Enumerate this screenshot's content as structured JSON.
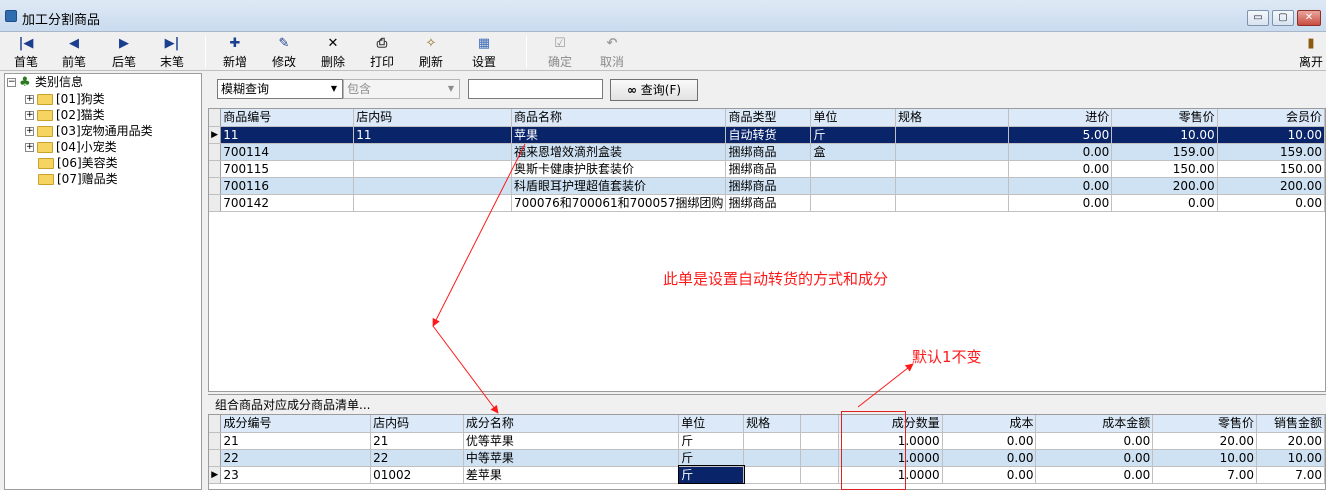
{
  "window": {
    "title": "加工分割商品",
    "min": "▭",
    "max": "▢",
    "close": "✕"
  },
  "toolbar": {
    "first": "首笔",
    "prev": "前笔",
    "next": "后笔",
    "last": "末笔",
    "add": "新增",
    "edit": "修改",
    "delete": "删除",
    "print": "打印",
    "refresh": "刷新",
    "settings": "设置",
    "confirm": "确定",
    "cancel": "取消",
    "exit": "离开"
  },
  "tree": {
    "root": "类别信息",
    "items": [
      "[01]狗类",
      "[02]猫类",
      "[03]宠物通用品类",
      "[04]小宠类",
      "[06]美容类",
      "[07]赠品类"
    ]
  },
  "search": {
    "mode": "模糊查询",
    "match": "包含",
    "query": "",
    "button": "查询(F)"
  },
  "products": {
    "columns": [
      "商品编号",
      "店内码",
      "商品名称",
      "商品类型",
      "单位",
      "规格",
      "进价",
      "零售价",
      "会员价"
    ],
    "rows": [
      [
        "11",
        "11",
        "苹果",
        "自动转货",
        "斤",
        "",
        "5.00",
        "10.00",
        "10.00"
      ],
      [
        "700114",
        "",
        "福来恩增效滴剂盒装",
        "捆绑商品",
        "盒",
        "",
        "0.00",
        "159.00",
        "159.00"
      ],
      [
        "700115",
        "",
        "奥斯卡健康护肤套装价",
        "捆绑商品",
        "",
        "",
        "0.00",
        "150.00",
        "150.00"
      ],
      [
        "700116",
        "",
        "科盾眼耳护理超值套装价",
        "捆绑商品",
        "",
        "",
        "0.00",
        "200.00",
        "200.00"
      ],
      [
        "700142",
        "",
        "700076和700061和700057捆绑团购",
        "捆绑商品",
        "",
        "",
        "0.00",
        "0.00",
        "0.00"
      ]
    ]
  },
  "components": {
    "caption": "组合商品对应成分商品清单...",
    "columns": [
      "成分编号",
      "店内码",
      "成分名称",
      "单位",
      "规格",
      "",
      "成分数量",
      "成本",
      "成本金额",
      "零售价",
      "销售金额"
    ],
    "rows": [
      [
        "21",
        "21",
        "优等苹果",
        "斤",
        "",
        "",
        "1.0000",
        "0.00",
        "0.00",
        "20.00",
        "20.00"
      ],
      [
        "22",
        "22",
        "中等苹果",
        "斤",
        "",
        "",
        "1.0000",
        "0.00",
        "0.00",
        "10.00",
        "10.00"
      ],
      [
        "23",
        "01002",
        "差苹果",
        "斤",
        "",
        "",
        "1.0000",
        "0.00",
        "0.00",
        "7.00",
        "7.00"
      ]
    ]
  },
  "annotations": {
    "note1": "此单是设置自动转货的方式和成分",
    "note2": "默认1不变"
  },
  "colors": {
    "annotation": "#ff1a1a",
    "selection": "#0a246a",
    "header": "#dbe9f8",
    "row_alt": "#cfe2f3"
  }
}
